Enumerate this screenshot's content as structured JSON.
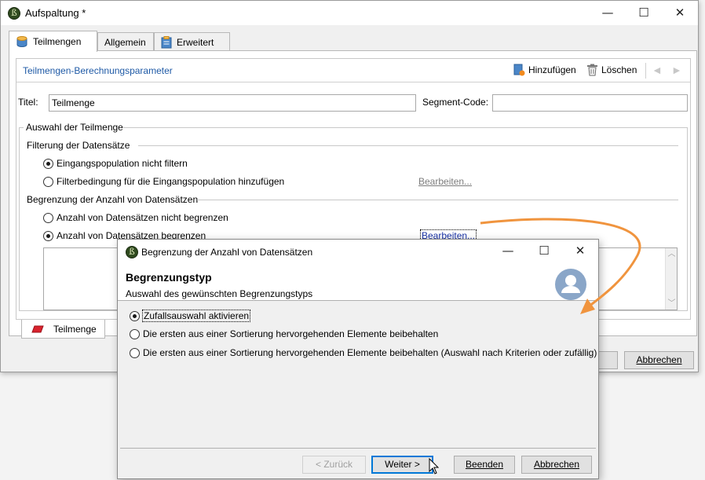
{
  "main_window": {
    "title": "Aufspaltung *",
    "app_icon_glyph": "ß",
    "window_controls": {
      "minimize": "—",
      "maximize": "☐",
      "close": "✕"
    },
    "tabs": [
      {
        "label": "Teilmengen",
        "icon": "database-icon"
      },
      {
        "label": "Allgemein",
        "icon": ""
      },
      {
        "label": "Erweitert",
        "icon": "clipboard-icon"
      }
    ],
    "section_title": "Teilmengen-Berechnungsparameter",
    "toolbar": {
      "add_label": "Hinzufügen",
      "delete_label": "Löschen",
      "prev_glyph": "◄",
      "next_glyph": "►"
    },
    "title_label": "Titel:",
    "title_value": "Teilmenge",
    "segment_label": "Segment-Code:",
    "segment_value": "",
    "subset_group_title": "Auswahl der Teilmenge",
    "filter_group_title": "Filterung der Datensätze",
    "filter_options": [
      {
        "label": "Eingangspopulation nicht filtern",
        "checked": true
      },
      {
        "label": "Filterbedingung für die Eingangspopulation hinzufügen",
        "checked": false
      }
    ],
    "filter_edit_link": "Bearbeiten...",
    "limit_group_title": "Begrenzung der Anzahl von Datensätzen",
    "limit_options": [
      {
        "label": "Anzahl von Datensätzen nicht begrenzen",
        "checked": false
      },
      {
        "label": "Anzahl von Datensätzen begrenzen",
        "checked": true
      }
    ],
    "limit_edit_link": "Bearbeiten...",
    "bottom_tab_label": "Teilmenge",
    "cancel_button": "Abbrechen",
    "ok_button": ""
  },
  "dialog": {
    "title": "Begrenzung der Anzahl von Datensätzen",
    "window_controls": {
      "minimize": "—",
      "maximize": "☐",
      "close": "✕"
    },
    "heading": "Begrenzungstyp",
    "subheading": "Auswahl des gewünschten Begrenzungstyps",
    "options": [
      {
        "label": "Zufallsauswahl aktivieren",
        "checked": true
      },
      {
        "label": "Die ersten aus einer Sortierung hervorgehenden Elemente beibehalten",
        "checked": false
      },
      {
        "label": "Die ersten aus einer Sortierung hervorgehenden Elemente beibehalten (Auswahl nach Kriterien oder zufällig)",
        "checked": false
      }
    ],
    "buttons": {
      "back": "< Zurück",
      "next": "Weiter >",
      "finish": "Beenden",
      "cancel": "Abbrechen"
    }
  },
  "colors": {
    "accent_arrow": "#f0943e",
    "link_blue": "#1f5aa6",
    "avatar": "#8aa6c8"
  }
}
